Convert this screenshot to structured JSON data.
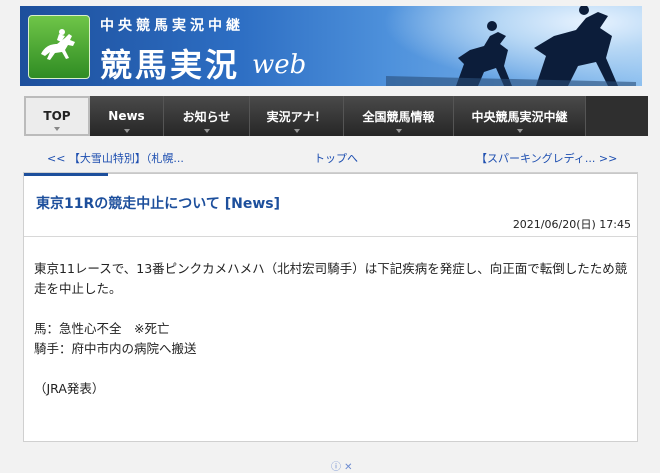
{
  "header": {
    "subtitle": "中央競馬実況中継",
    "title": "競馬実況",
    "title_suffix": "web",
    "colors": {
      "banner": "#1d4f9c",
      "logo": "#4aa838"
    }
  },
  "nav": {
    "items": [
      {
        "label": "TOP",
        "active": true
      },
      {
        "label": "News"
      },
      {
        "label": "お知らせ"
      },
      {
        "label": "実況アナ！"
      },
      {
        "label": "全国競馬情報"
      },
      {
        "label": "中央競馬実況中継"
      }
    ]
  },
  "pager": {
    "prev": "<< 【大雪山特別】（札幌...",
    "top": "トップへ",
    "next": "【スパーキングレディ... >>"
  },
  "article": {
    "title": "東京11Rの競走中止について [News]",
    "date": "2021/06/20(日) 17:45",
    "paragraph1": "東京11レースで、13番ピンクカメハメハ（北村宏司騎手）は下記疾病を発症し、向正面で転倒したため競走を中止した。",
    "horse_line": "馬：急性心不全　※死亡",
    "jockey_line": "騎手：府中市内の病院へ搬送",
    "source": "（JRA発表）"
  },
  "ad_icon": "ⓘ ✕"
}
